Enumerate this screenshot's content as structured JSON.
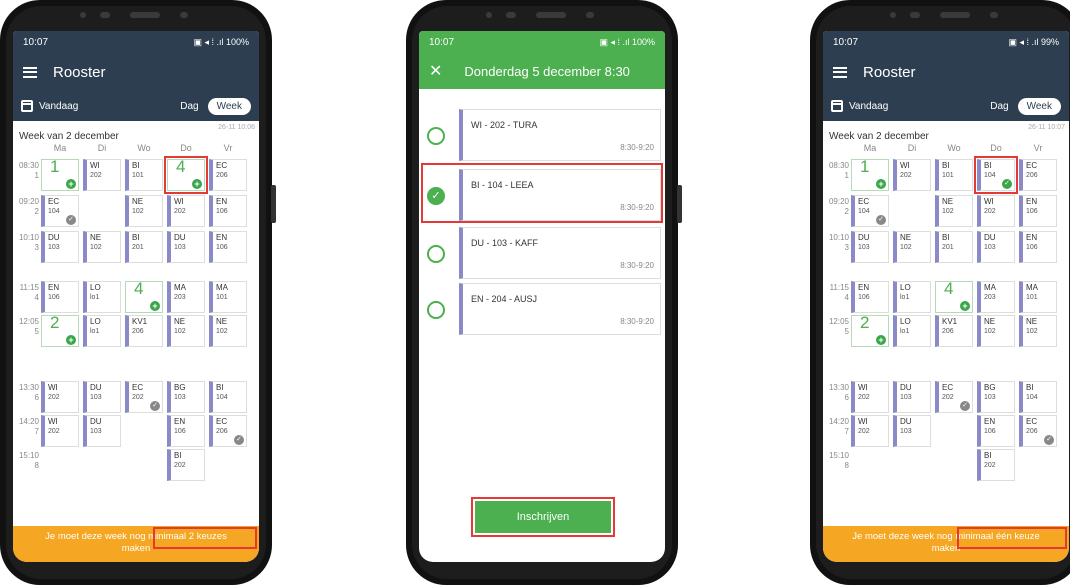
{
  "colors": {
    "appbar": "#2c3e50",
    "accent_green": "#4caf50",
    "banner": "#f5a623",
    "highlight": "#e53935",
    "cell_bar": "#8a8ac6"
  },
  "left": {
    "status_time": "10:07",
    "status_right": "▣ ◂ ⁞ .ıl 100%",
    "title": "Rooster",
    "today": "Vandaag",
    "toggle_day": "Dag",
    "toggle_week": "Week",
    "week_title": "Week van 2 december",
    "updated": "26-11 10:06",
    "cell_4_label": "4",
    "banner_line1": "Je moet deze week nog minimaal 2 keuzes",
    "banner_line2": "maken"
  },
  "right": {
    "status_time": "10:07",
    "status_right": "▣ ◂ ⁞ .ıl 99%",
    "title": "Rooster",
    "today": "Vandaag",
    "toggle_day": "Dag",
    "toggle_week": "Week",
    "week_title": "Week van 2 december",
    "updated": "26-11 10:07",
    "banner_line1": "Je moet deze week nog minimaal één keuze",
    "banner_line2": "maken"
  },
  "days": [
    "Ma",
    "Di",
    "Wo",
    "Do",
    "Vr"
  ],
  "slots": [
    {
      "time": "08:30",
      "num": "1"
    },
    {
      "time": "09:20",
      "num": "2"
    },
    {
      "time": "10:10",
      "num": "3"
    },
    {
      "time": "11:15",
      "num": "4"
    },
    {
      "time": "12:05",
      "num": "5"
    },
    {
      "time": "13:30",
      "num": "6"
    },
    {
      "time": "14:20",
      "num": "7"
    },
    {
      "time": "15:10",
      "num": "8"
    }
  ],
  "cells": {
    "c_ma_1": "1",
    "c_di_1a": "WI",
    "c_di_1b": "202",
    "c_wo_1a": "BI",
    "c_wo_1b": "101",
    "c_vr_1a": "EC",
    "c_vr_1b": "206",
    "c_ma_2a": "EC",
    "c_ma_2b": "104",
    "c_wo_2a": "NE",
    "c_wo_2b": "102",
    "c_do_2a": "WI",
    "c_do_2b": "202",
    "c_vr_2a": "EN",
    "c_vr_2b": "106",
    "c_ma_3a": "DU",
    "c_ma_3b": "103",
    "c_di_3a": "NE",
    "c_di_3b": "102",
    "c_wo_3a": "BI",
    "c_wo_3b": "201",
    "c_do_3a": "DU",
    "c_do_3b": "103",
    "c_vr_3a": "EN",
    "c_vr_3b": "106",
    "c_ma_4a": "EN",
    "c_ma_4b": "106",
    "c_di_4a": "LO",
    "c_di_4b": "lo1",
    "c_wo_4": "4",
    "c_do_4a": "MA",
    "c_do_4b": "203",
    "c_vr_4a": "MA",
    "c_vr_4b": "101",
    "c_ma_5": "2",
    "c_di_5a": "LO",
    "c_di_5b": "lo1",
    "c_wo_5a": "KV1",
    "c_wo_5b": "206",
    "c_do_5a": "NE",
    "c_do_5b": "102",
    "c_vr_5a": "NE",
    "c_vr_5b": "102",
    "c_ma_6a": "WI",
    "c_ma_6b": "202",
    "c_di_6a": "DU",
    "c_di_6b": "103",
    "c_wo_6a": "EC",
    "c_wo_6b": "202",
    "c_do_6a": "BG",
    "c_do_6b": "103",
    "c_vr_6a": "BI",
    "c_vr_6b": "104",
    "c_ma_7a": "WI",
    "c_ma_7b": "202",
    "c_di_7a": "DU",
    "c_di_7b": "103",
    "c_do_7a": "EN",
    "c_do_7b": "106",
    "c_vr_7a": "EC",
    "c_vr_7b": "206",
    "c_do_8a": "BI",
    "c_do_8b": "202",
    "r_do_1a": "BI",
    "r_do_1b": "104"
  },
  "choice": {
    "status_time": "10:07",
    "status_right": "▣ ◂ ⁞ .ıl 100%",
    "title": "Donderdag 5 december 8:30",
    "options": [
      {
        "label": "WI - 202 - TURA",
        "time": "8:30-9:20",
        "selected": false
      },
      {
        "label": "BI - 104 - LEEA",
        "time": "8:30-9:20",
        "selected": true
      },
      {
        "label": "DU - 103 - KAFF",
        "time": "8:30-9:20",
        "selected": false
      },
      {
        "label": "EN - 204 - AUSJ",
        "time": "8:30-9:20",
        "selected": false
      }
    ],
    "enroll": "Inschrijven"
  }
}
